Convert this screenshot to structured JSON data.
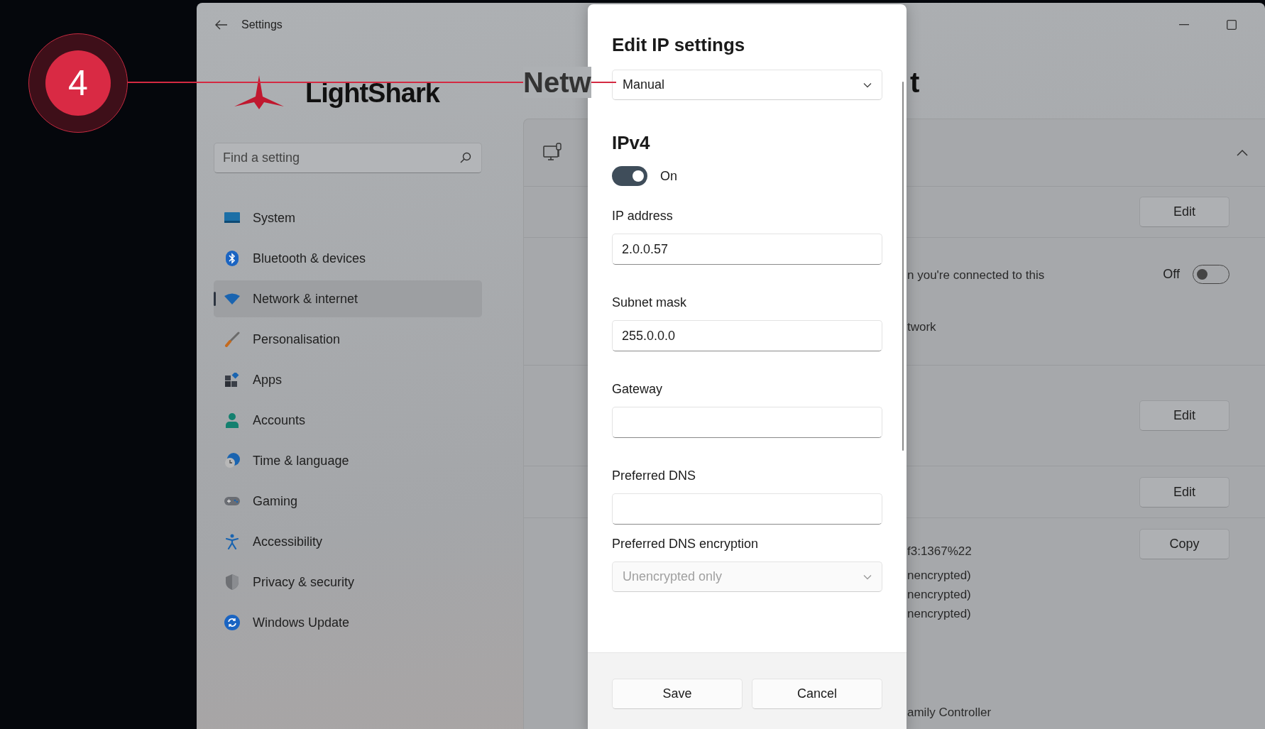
{
  "callout": {
    "number": "4"
  },
  "window": {
    "title": "Settings",
    "logo_text": "LightShark"
  },
  "search": {
    "placeholder": "Find a setting"
  },
  "sidebar": {
    "items": [
      {
        "label": "System",
        "selected": false
      },
      {
        "label": "Bluetooth & devices",
        "selected": false
      },
      {
        "label": "Network & internet",
        "selected": true
      },
      {
        "label": "Personalisation",
        "selected": false
      },
      {
        "label": "Apps",
        "selected": false
      },
      {
        "label": "Accounts",
        "selected": false
      },
      {
        "label": "Time & language",
        "selected": false
      },
      {
        "label": "Gaming",
        "selected": false
      },
      {
        "label": "Accessibility",
        "selected": false
      },
      {
        "label": "Privacy & security",
        "selected": false
      },
      {
        "label": "Windows Update",
        "selected": false
      }
    ]
  },
  "page": {
    "heading": "Netw",
    "heading_tail": "t",
    "rows": [
      {
        "kind": "header",
        "expanded": true
      },
      {
        "kind": "button",
        "label": "Edit"
      },
      {
        "kind": "toggle",
        "label": "Off",
        "on": false,
        "texts": [
          [
            "n you're connected to this"
          ],
          [
            "twork"
          ]
        ]
      },
      {
        "kind": "button",
        "label": "Edit"
      },
      {
        "kind": "button",
        "label": "Edit"
      },
      {
        "kind": "button",
        "label": "Copy",
        "texts": [
          [
            "f3:1367%22"
          ],
          [
            "nencrypted)",
            "nencrypted)",
            "nencrypted)"
          ],
          [
            "amily Controller"
          ]
        ]
      }
    ]
  },
  "dialog": {
    "title": "Edit IP settings",
    "mode": "Manual",
    "section": "IPv4",
    "toggle": {
      "on": true,
      "label": "On"
    },
    "fields": [
      {
        "label": "IP address",
        "value": "2.0.0.57"
      },
      {
        "label": "Subnet mask",
        "value": "255.0.0.0"
      },
      {
        "label": "Gateway"
      },
      {
        "label": "Preferred DNS"
      }
    ],
    "encryption": {
      "label": "Preferred DNS encryption",
      "value": "Unencrypted only",
      "disabled": true
    },
    "buttons": [
      "Save",
      "Cancel"
    ]
  }
}
